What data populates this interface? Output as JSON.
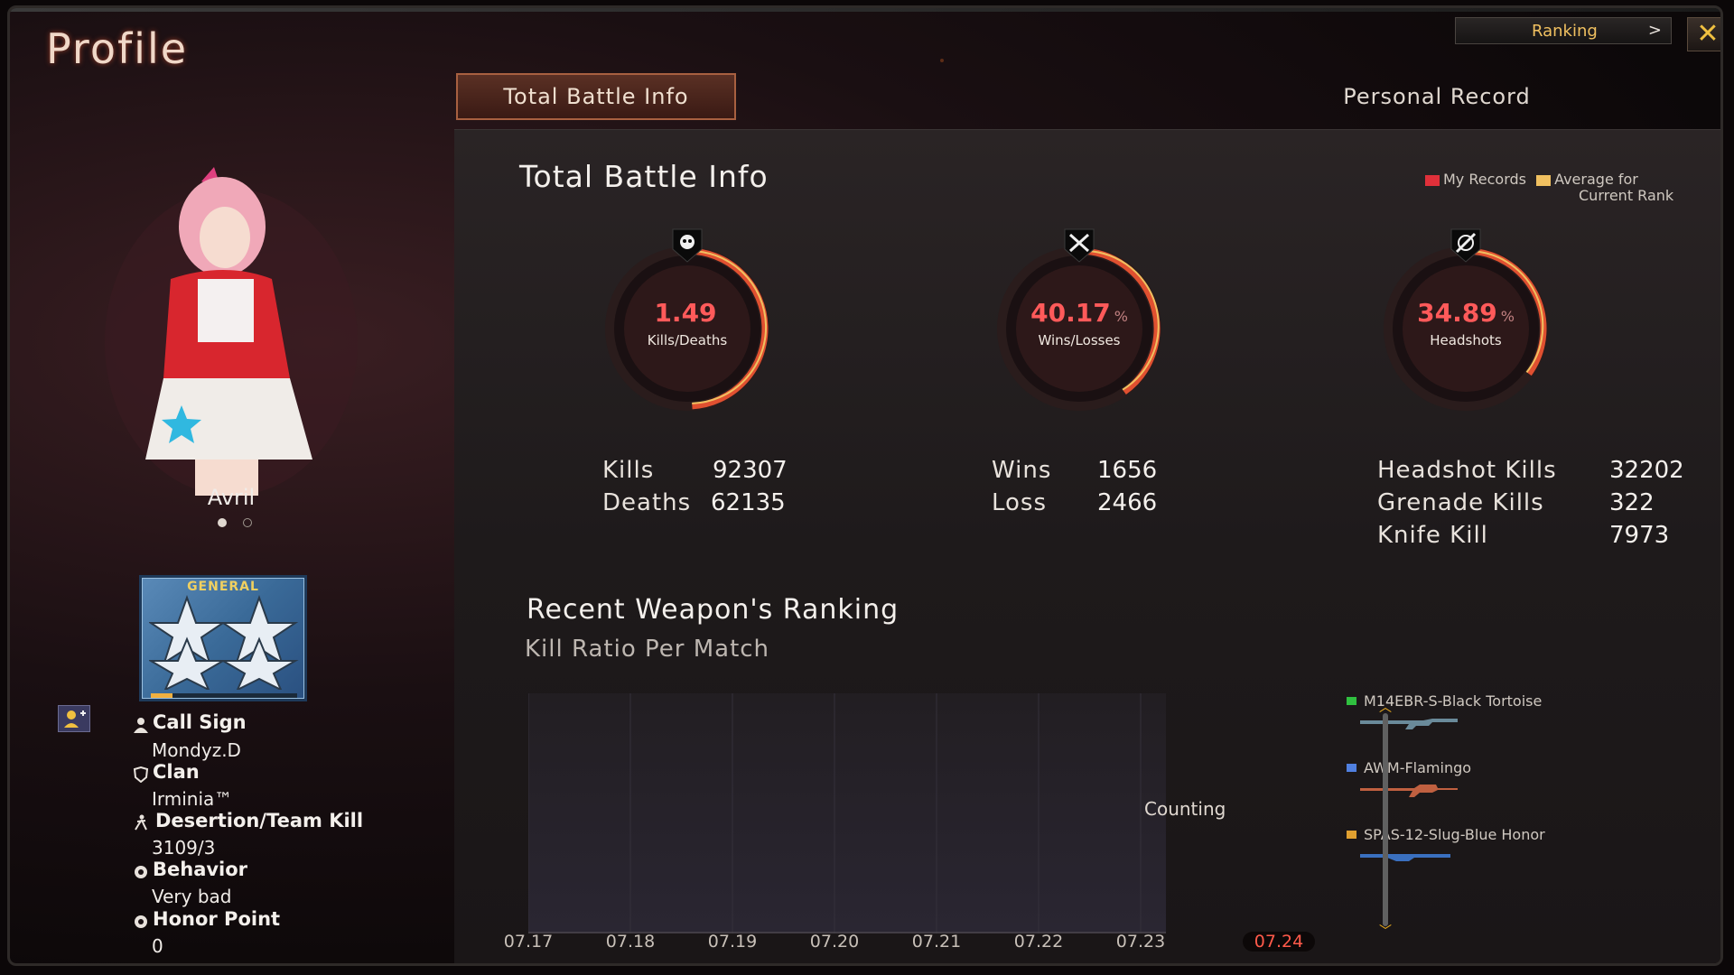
{
  "header": {
    "title": "Profile",
    "ranking_label": "Ranking",
    "ranking_chevron": ">",
    "close_glyph": "✕"
  },
  "tabs": [
    {
      "label": "Total Battle Info",
      "active": true
    },
    {
      "label": "Personal Record",
      "active": false
    }
  ],
  "battle_info": {
    "title": "Total Battle Info",
    "legend": {
      "my_records": "My Records",
      "average_line1": "Average for",
      "average_line2": "Current Rank",
      "my_color": "#e0303a",
      "avg_color": "#f0c060"
    },
    "gauges": [
      {
        "value": "1.49",
        "unit": "",
        "label": "Kills/Deaths",
        "icon": "skull-icon",
        "fill_fraction": 0.49
      },
      {
        "value": "40.17",
        "unit": "%",
        "label": "Wins/Losses",
        "icon": "crossed-swords-icon",
        "fill_fraction": 0.4017
      },
      {
        "value": "34.89",
        "unit": "%",
        "label": "Headshots",
        "icon": "crosshair-icon",
        "fill_fraction": 0.3489
      }
    ],
    "stats": {
      "kills_label": "Kills",
      "kills": "92307",
      "deaths_label": "Deaths",
      "deaths": "62135",
      "wins_label": "Wins",
      "wins": "1656",
      "loss_label": "Loss",
      "loss": "2466",
      "headshot_kills_label": "Headshot Kills",
      "headshot_kills": "32202",
      "grenade_kills_label": "Grenade Kills",
      "grenade_kills": "322",
      "knife_kill_label": "Knife Kill",
      "knife_kill": "7973"
    }
  },
  "weapon_ranking": {
    "title": "Recent Weapon's Ranking",
    "subtitle": "Kill Ratio Per Match",
    "status_text": "Counting",
    "weapons": [
      {
        "name": "M14EBR-S-Black Tortoise",
        "color": "#30c040"
      },
      {
        "name": "AWM-Flamingo",
        "color": "#5080e0"
      },
      {
        "name": "SPAS-12-Slug-Blue Honor",
        "color": "#e0a030"
      }
    ]
  },
  "chart_data": {
    "type": "line",
    "title": "Kill Ratio Per Match",
    "x": [
      "07.17",
      "07.18",
      "07.19",
      "07.20",
      "07.21",
      "07.22",
      "07.23",
      "07.24"
    ],
    "selected_x": "07.24",
    "series": [],
    "grid": true
  },
  "character": {
    "name": "Avril",
    "page_dots": 2,
    "active_dot": 0
  },
  "rank": {
    "title": "GENERAL",
    "progress": 0.15
  },
  "player_info": {
    "call_sign_label": "Call Sign",
    "call_sign": "Mondyz.D",
    "clan_label": "Clan",
    "clan": "Irminia™",
    "desertion_label": "Desertion/Team Kill",
    "desertion": "3109/3",
    "behavior_label": "Behavior",
    "behavior": "Very bad",
    "honor_label": "Honor Point",
    "honor": "0"
  }
}
